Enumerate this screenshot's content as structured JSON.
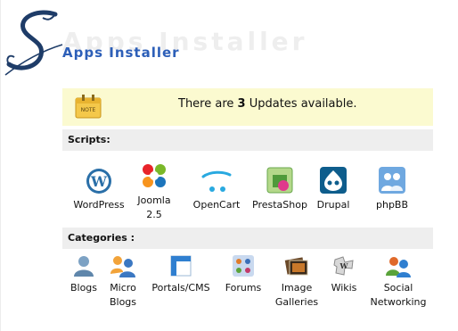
{
  "header": {
    "title": "Apps Installer",
    "ghost_title": "Apps Installer"
  },
  "update_notice": {
    "text_before": "There are ",
    "count": "3",
    "text_after": " Updates available.",
    "icon": "note-icon"
  },
  "scripts": {
    "heading": "Scripts:",
    "items": [
      {
        "label": "WordPress",
        "icon": "wordpress-icon"
      },
      {
        "label": "Joomla",
        "label2": "2.5",
        "icon": "joomla-icon"
      },
      {
        "label": "OpenCart",
        "icon": "opencart-icon"
      },
      {
        "label": "PrestaShop",
        "icon": "prestashop-icon"
      },
      {
        "label": "Drupal",
        "icon": "drupal-icon"
      },
      {
        "label": "phpBB",
        "icon": "phpbb-icon"
      }
    ]
  },
  "categories": {
    "heading": "Categories :",
    "items": [
      {
        "label": "Blogs",
        "icon": "blogs-icon"
      },
      {
        "label": "Micro",
        "label2": "Blogs",
        "icon": "micro-blogs-icon"
      },
      {
        "label": "Portals/CMS",
        "icon": "portals-cms-icon"
      },
      {
        "label": "Forums",
        "icon": "forums-icon"
      },
      {
        "label": "Image",
        "label2": "Galleries",
        "icon": "image-galleries-icon"
      },
      {
        "label": "Wikis",
        "icon": "wikis-icon"
      },
      {
        "label": "Social",
        "label2": "Networking",
        "icon": "social-networking-icon"
      }
    ]
  },
  "colors": {
    "title_blue": "#2d5fb8",
    "update_bg": "#fbfad0",
    "section_bg": "#eeeeee"
  }
}
